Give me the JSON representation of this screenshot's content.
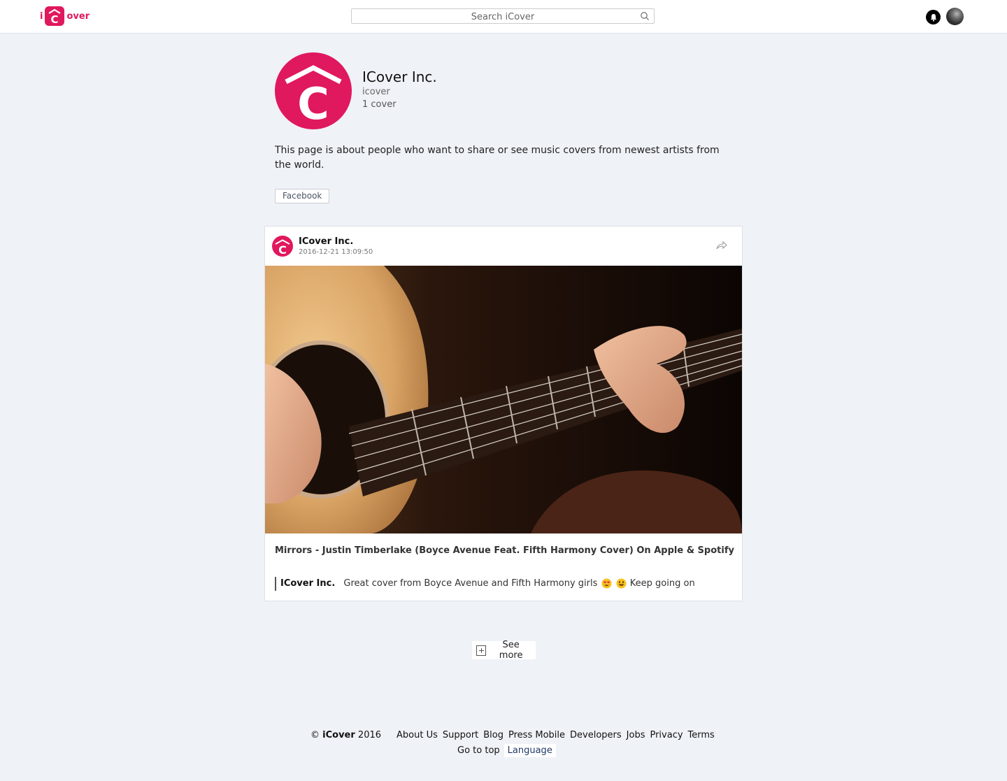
{
  "header": {
    "logo_left": "i",
    "logo_right": "over",
    "search_placeholder": "Search iCover",
    "notifications_icon": "bell-icon",
    "avatar_icon": "user-avatar"
  },
  "brand_color": "#e0185d",
  "profile": {
    "name": "ICover Inc.",
    "handle": "icover",
    "count": "1 cover",
    "about": "This page is about people who want to share or see music covers from newest artists from the world.",
    "facebook_label": "Facebook"
  },
  "post": {
    "author": "ICover Inc.",
    "date": "2016-12-21 13:09:50",
    "share_icon": "share-icon",
    "title": "Mirrors - Justin Timberlake (Boyce Avenue Feat. Fifth Harmony Cover) On Apple & Spotify",
    "comment_author": "ICover Inc.",
    "comment_text_1": "Great cover from Boyce Avenue and Fifth Harmony girls",
    "comment_text_2": "Keep going on"
  },
  "see_more": "See more",
  "footer": {
    "copyright": "© iCover 2016",
    "copy_symbol": "©",
    "copy_brand": "iCover",
    "copy_year": "2016",
    "links": [
      "About Us",
      "Support",
      "Blog",
      "Press Mobile",
      "Developers",
      "Jobs",
      "Privacy",
      "Terms"
    ],
    "go_to_top": "Go to top",
    "language": "Language"
  }
}
